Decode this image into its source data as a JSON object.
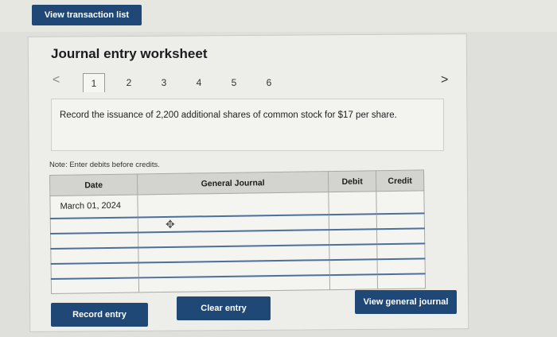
{
  "header": {
    "view_transaction_list_label": "View transaction list"
  },
  "worksheet": {
    "title": "Journal entry worksheet",
    "tabs": [
      "1",
      "2",
      "3",
      "4",
      "5",
      "6"
    ],
    "active_tab": "1",
    "prev_arrow": "<",
    "next_arrow": ">",
    "instruction": "Record the issuance of 2,200 additional shares of common stock for $17 per share.",
    "note": "Note: Enter debits before credits."
  },
  "journal": {
    "headers": {
      "date": "Date",
      "general_journal": "General Journal",
      "debit": "Debit",
      "credit": "Credit"
    },
    "rows": [
      {
        "date": "March 01, 2024",
        "account": "",
        "debit": "",
        "credit": ""
      },
      {
        "date": "",
        "account": "",
        "debit": "",
        "credit": ""
      },
      {
        "date": "",
        "account": "",
        "debit": "",
        "credit": ""
      },
      {
        "date": "",
        "account": "",
        "debit": "",
        "credit": ""
      },
      {
        "date": "",
        "account": "",
        "debit": "",
        "credit": ""
      },
      {
        "date": "",
        "account": "",
        "debit": "",
        "credit": ""
      }
    ]
  },
  "actions": {
    "record_entry_label": "Record entry",
    "clear_entry_label": "Clear entry",
    "view_general_journal_label": "View general journal"
  },
  "colors": {
    "button_bg": "#1f4876",
    "button_text": "#ffffff",
    "header_bg": "#d3d3cf"
  }
}
